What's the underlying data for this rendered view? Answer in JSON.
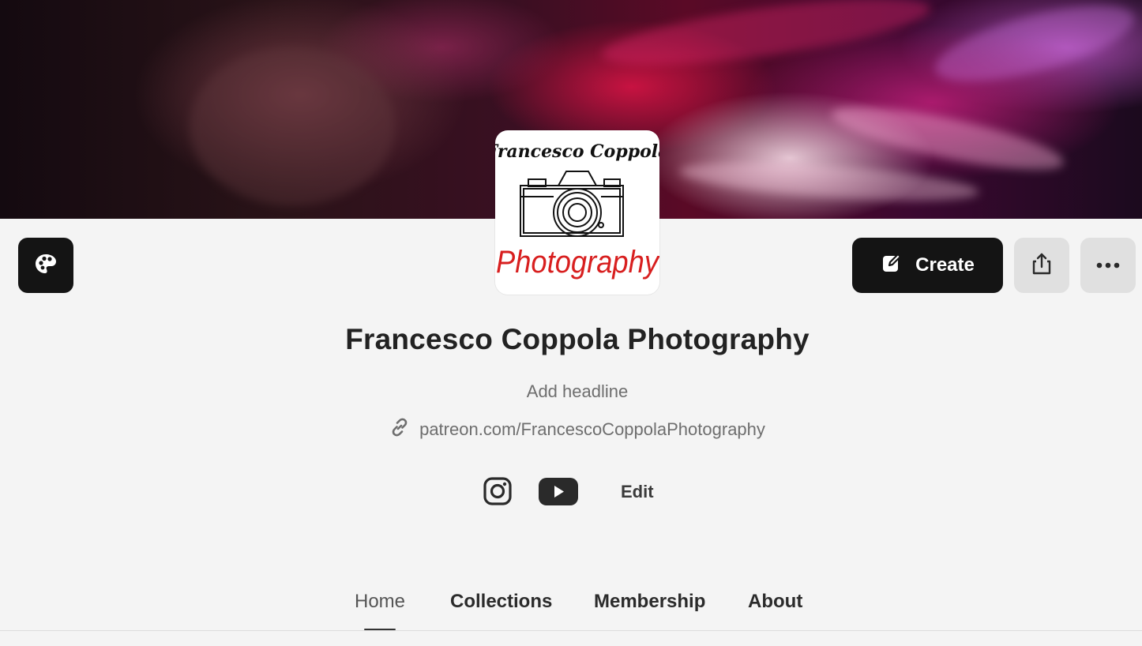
{
  "profile": {
    "name": "Francesco Coppola Photography",
    "headline_placeholder": "Add headline",
    "url": "patreon.com/FrancescoCoppolaPhotography",
    "logo_top_text": "Francesco Coppola",
    "logo_bottom_text": "Photography"
  },
  "actions": {
    "create_label": "Create",
    "edit_label": "Edit"
  },
  "icons": {
    "customize": "palette-icon",
    "create": "edit-pencil-icon",
    "share": "share-icon",
    "more": "more-horizontal-icon",
    "link": "link-icon",
    "instagram": "instagram-icon",
    "youtube": "youtube-icon"
  },
  "tabs": [
    {
      "label": "Home",
      "active": true
    },
    {
      "label": "Collections",
      "active": false
    },
    {
      "label": "Membership",
      "active": false
    },
    {
      "label": "About",
      "active": false
    }
  ],
  "colors": {
    "dark_button": "#141414",
    "grey_button": "#e0e0e0",
    "logo_red": "#d81f1f",
    "background": "#f4f4f4"
  }
}
